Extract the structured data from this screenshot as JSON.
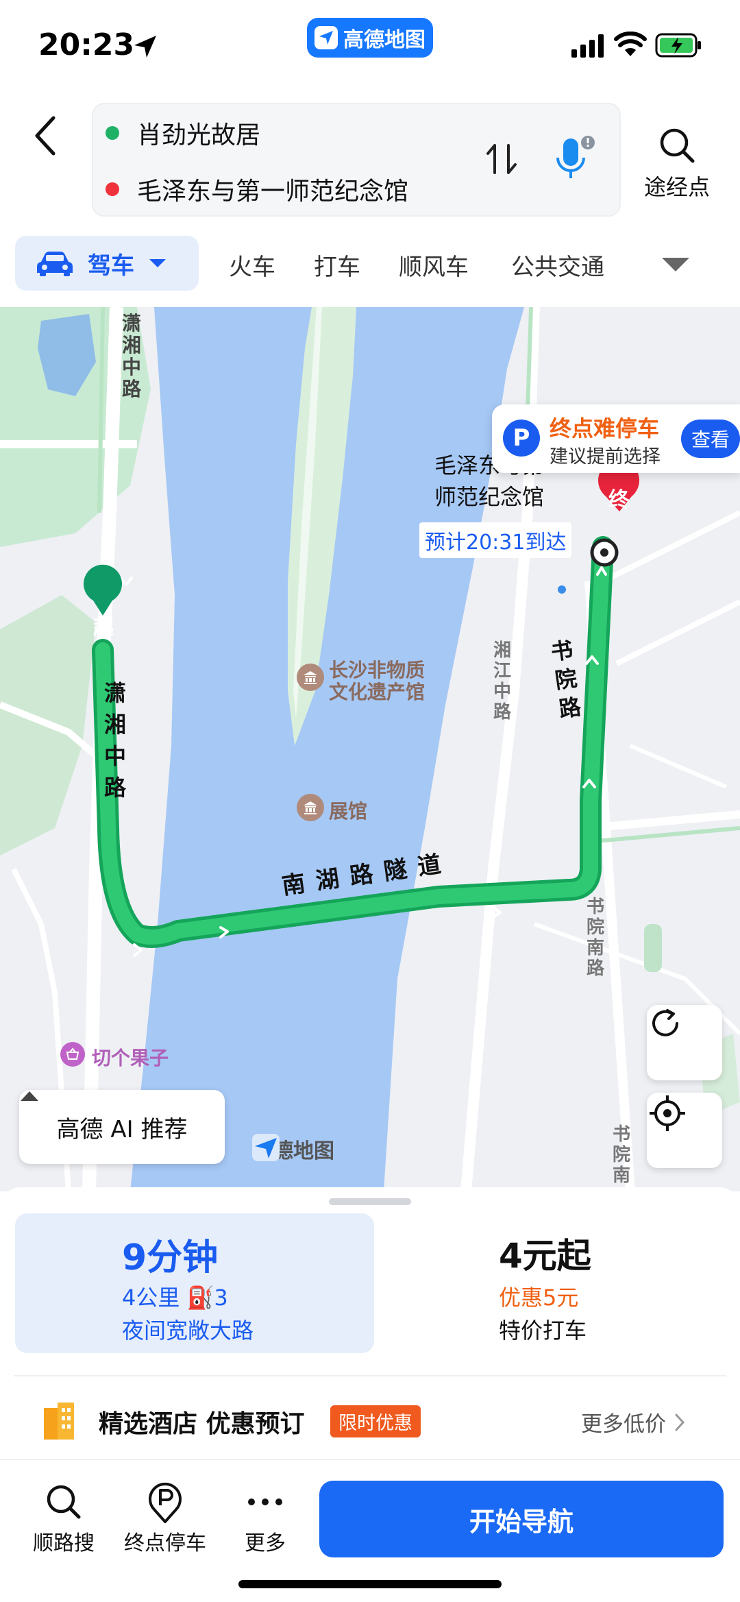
{
  "status_bar": {
    "time": "20:23",
    "pill_label": "高德地图"
  },
  "route": {
    "origin": "肖劲光故居",
    "destination": "毛泽东与第一师范纪念馆",
    "waypoint_label": "途经点"
  },
  "modes": {
    "active": "驾车",
    "items": [
      "火车",
      "打车",
      "顺风车",
      "公共交通"
    ]
  },
  "map": {
    "labels": {
      "xiaoxiang_n": "潇湘中路",
      "xiaoxiang_s": "潇湘中路",
      "nanhu_tunnel": "南湖路隧道",
      "shuyuan": "书院路",
      "shuyuan_s": "书院南路",
      "xiangjiang": "湘江中路",
      "museum": "长沙非物质文化遗产馆",
      "exhibit": "展馆",
      "fruit": "切个果子",
      "dest_name": "毛泽东与第一师范纪念馆",
      "shuyuan_bottom": "书院南",
      "start_marker": "起",
      "end_marker": "终"
    },
    "parking": {
      "title": "终点难停车",
      "subtitle": "建议提前选择",
      "action": "查看"
    },
    "eta": "预计20:31到达",
    "ai_recommend": "高德 AI 推荐",
    "watermark": "高德地图"
  },
  "route_option": {
    "time": "9分钟",
    "info": "4公里  ⛽3",
    "tag": "夜间宽敞大路"
  },
  "taxi_option": {
    "price": "4元起",
    "discount": "优惠5元",
    "label": "特价打车"
  },
  "hotel": {
    "title": "精选酒店 优惠预订",
    "badge": "限时优惠",
    "more": "更多低价"
  },
  "bottom_bar": {
    "search_along": "顺路搜",
    "dest_parking": "终点停车",
    "more": "更多",
    "start": "开始导航"
  },
  "colors": {
    "accent": "#1a5cf0",
    "route": "#1fb266",
    "river": "#a6c8f5"
  }
}
